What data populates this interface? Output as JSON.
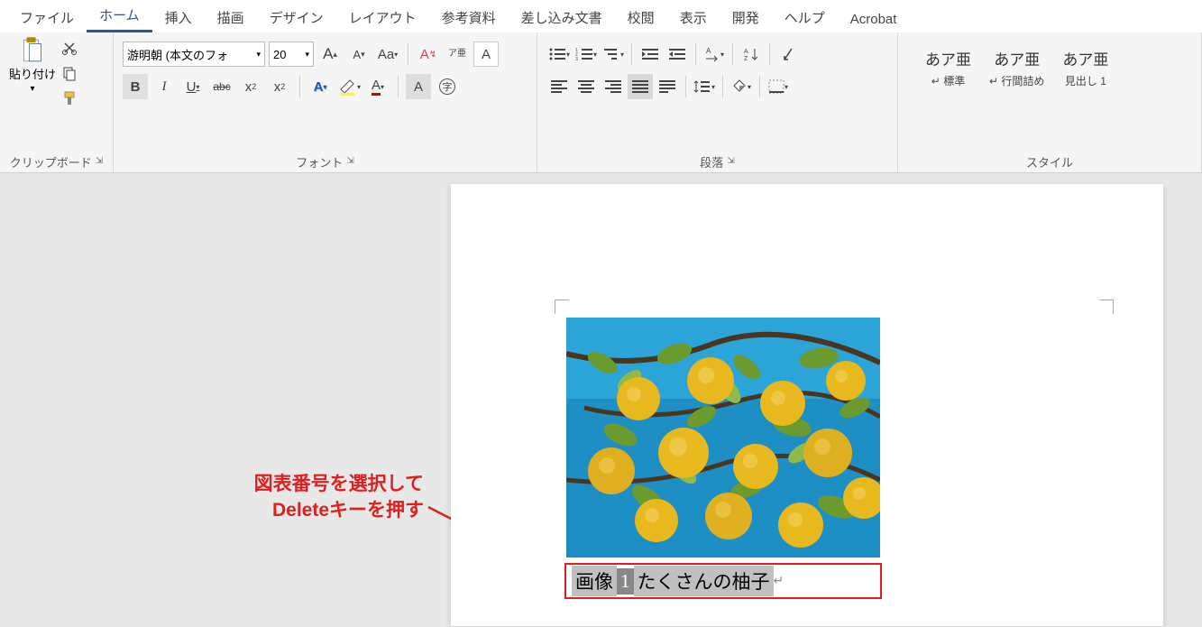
{
  "menubar": {
    "tabs": [
      "ファイル",
      "ホーム",
      "挿入",
      "描画",
      "デザイン",
      "レイアウト",
      "参考資料",
      "差し込み文書",
      "校閲",
      "表示",
      "開発",
      "ヘルプ",
      "Acrobat"
    ],
    "active_index": 1
  },
  "ribbon": {
    "clipboard": {
      "label": "クリップボード",
      "paste": "貼り付け"
    },
    "font": {
      "label": "フォント",
      "name": "游明朝 (本文のフォ",
      "size": "20",
      "aa": "Aa",
      "ruby": "ア亜",
      "bold": "B",
      "italic": "I",
      "underline": "U",
      "strike": "abc",
      "sub": "x₂",
      "sup": "x²",
      "text_effect": "A",
      "highlight": "ab",
      "font_color": "A",
      "char_shade": "A",
      "enclose": "字"
    },
    "paragraph": {
      "label": "段落"
    },
    "styles": {
      "label": "スタイル",
      "items": [
        {
          "preview": "あア亜",
          "name": "標準"
        },
        {
          "preview": "あア亜",
          "name": "行間詰め"
        },
        {
          "preview": "あア亜",
          "name": "見出し 1"
        }
      ]
    }
  },
  "document": {
    "caption_prefix": "画像",
    "caption_number": "1",
    "caption_text": "たくさんの柚子"
  },
  "annotation": {
    "line1": "図表番号を選択して",
    "line2": "Deleteキーを押す"
  }
}
